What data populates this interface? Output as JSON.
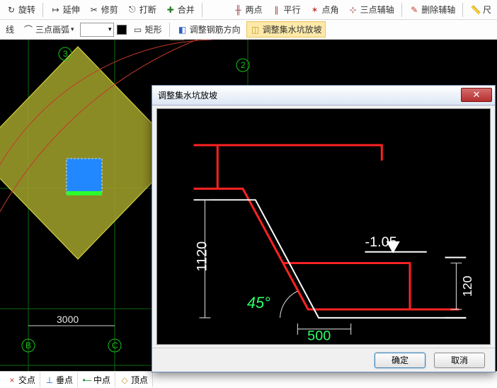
{
  "toolbar1": {
    "rotate": "旋转",
    "extend": "延伸",
    "trim": "修剪",
    "break": "打断",
    "merge": "合并",
    "two_point": "两点",
    "parallel": "平行",
    "point_angle": "点角",
    "three_point_aux": "三点辅轴",
    "delete_aux": "删除辅轴",
    "ruler": "尺"
  },
  "toolbar2": {
    "line": "线",
    "three_point_arc": "三点画弧",
    "rect": "矩形",
    "adjust_rebar_dir": "调整钢筋方向",
    "adjust_sump_slope": "调整集水坑放坡"
  },
  "snap": {
    "intersect": "交点",
    "perp": "垂点",
    "mid": "中点",
    "vertex": "顶点"
  },
  "dialog": {
    "title": "调整集水坑放坡",
    "ok": "确定",
    "cancel": "取消",
    "dim_v": "1120",
    "dim_h": "500",
    "angle": "45°",
    "elev": "-1.05",
    "dim_r": "120"
  },
  "canvas_labels": {
    "node2": "2",
    "node3": "3",
    "nodeB": "B",
    "nodeC": "C",
    "dim3000": "3000"
  },
  "colors": {
    "accent_red": "#ff0000",
    "accent_green": "#00ff66",
    "accent_yellow": "#b3b33a",
    "select_blue": "#2288ff"
  }
}
